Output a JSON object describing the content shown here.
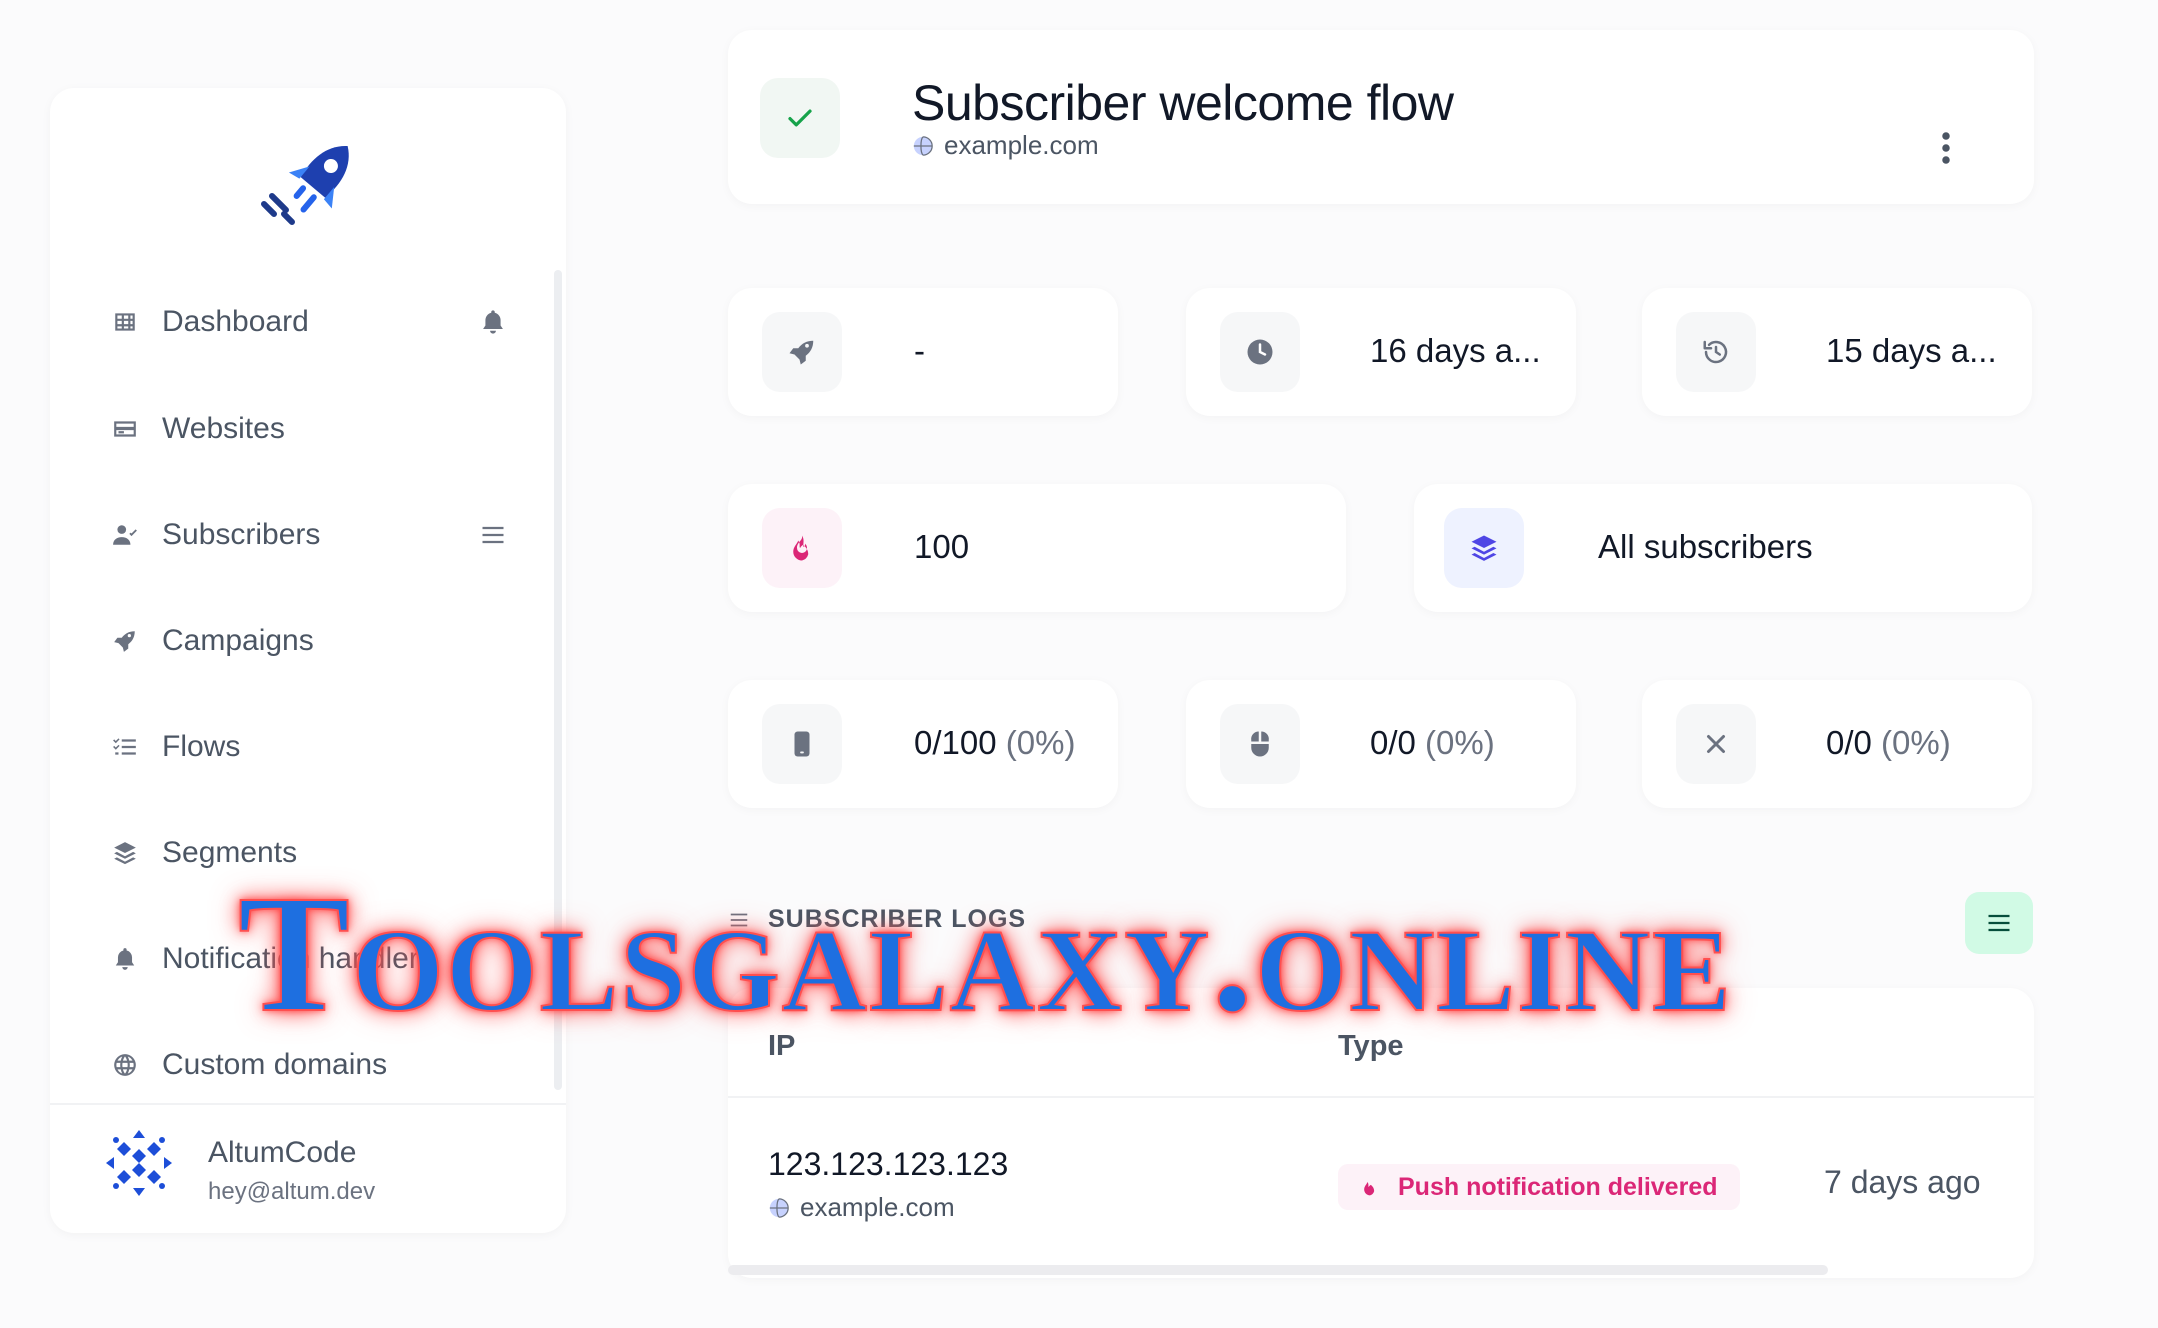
{
  "sidebar": {
    "items": [
      {
        "label": "Dashboard",
        "icon": "table-grid-icon",
        "extra": "bell-icon"
      },
      {
        "label": "Websites",
        "icon": "credit-card-icon"
      },
      {
        "label": "Subscribers",
        "icon": "user-check-icon",
        "extra": "hamburger-icon"
      },
      {
        "label": "Campaigns",
        "icon": "rocket-icon"
      },
      {
        "label": "Flows",
        "icon": "list-check-icon"
      },
      {
        "label": "Segments",
        "icon": "layers-icon"
      },
      {
        "label": "Notification handlers",
        "icon": "bell-icon"
      },
      {
        "label": "Custom domains",
        "icon": "globe-icon"
      }
    ],
    "user": {
      "name": "AltumCode",
      "email": "hey@altum.dev"
    }
  },
  "header": {
    "title": "Subscriber welcome flow",
    "website": "example.com"
  },
  "stats_row1": [
    {
      "icon": "rocket-icon",
      "value": "-"
    },
    {
      "icon": "clock-icon",
      "value": "16 days a..."
    },
    {
      "icon": "history-icon",
      "value": "15 days a..."
    }
  ],
  "stats_row2": [
    {
      "icon": "fire-icon",
      "value": "100"
    },
    {
      "icon": "layers-icon",
      "value": "All subscribers"
    }
  ],
  "stats_row3": [
    {
      "icon": "mobile-icon",
      "value": "0/100",
      "percent": "(0%)"
    },
    {
      "icon": "mouse-icon",
      "value": "0/0",
      "percent": "(0%)"
    },
    {
      "icon": "close-icon",
      "value": "0/0",
      "percent": "(0%)"
    }
  ],
  "logs": {
    "title": "SUBSCRIBER LOGS",
    "columns": [
      "IP",
      "Type"
    ],
    "rows": [
      {
        "ip": "123.123.123.123",
        "website": "example.com",
        "type": "Push notification delivered",
        "date": "7 days ago"
      }
    ]
  },
  "watermark": "Toolsgalaxy.online",
  "colors": {
    "accent": "#1e40af",
    "success": "#16a34a",
    "pink": "#db2777",
    "indigo": "#4f46e5",
    "filter_bg": "#d1fae5"
  }
}
